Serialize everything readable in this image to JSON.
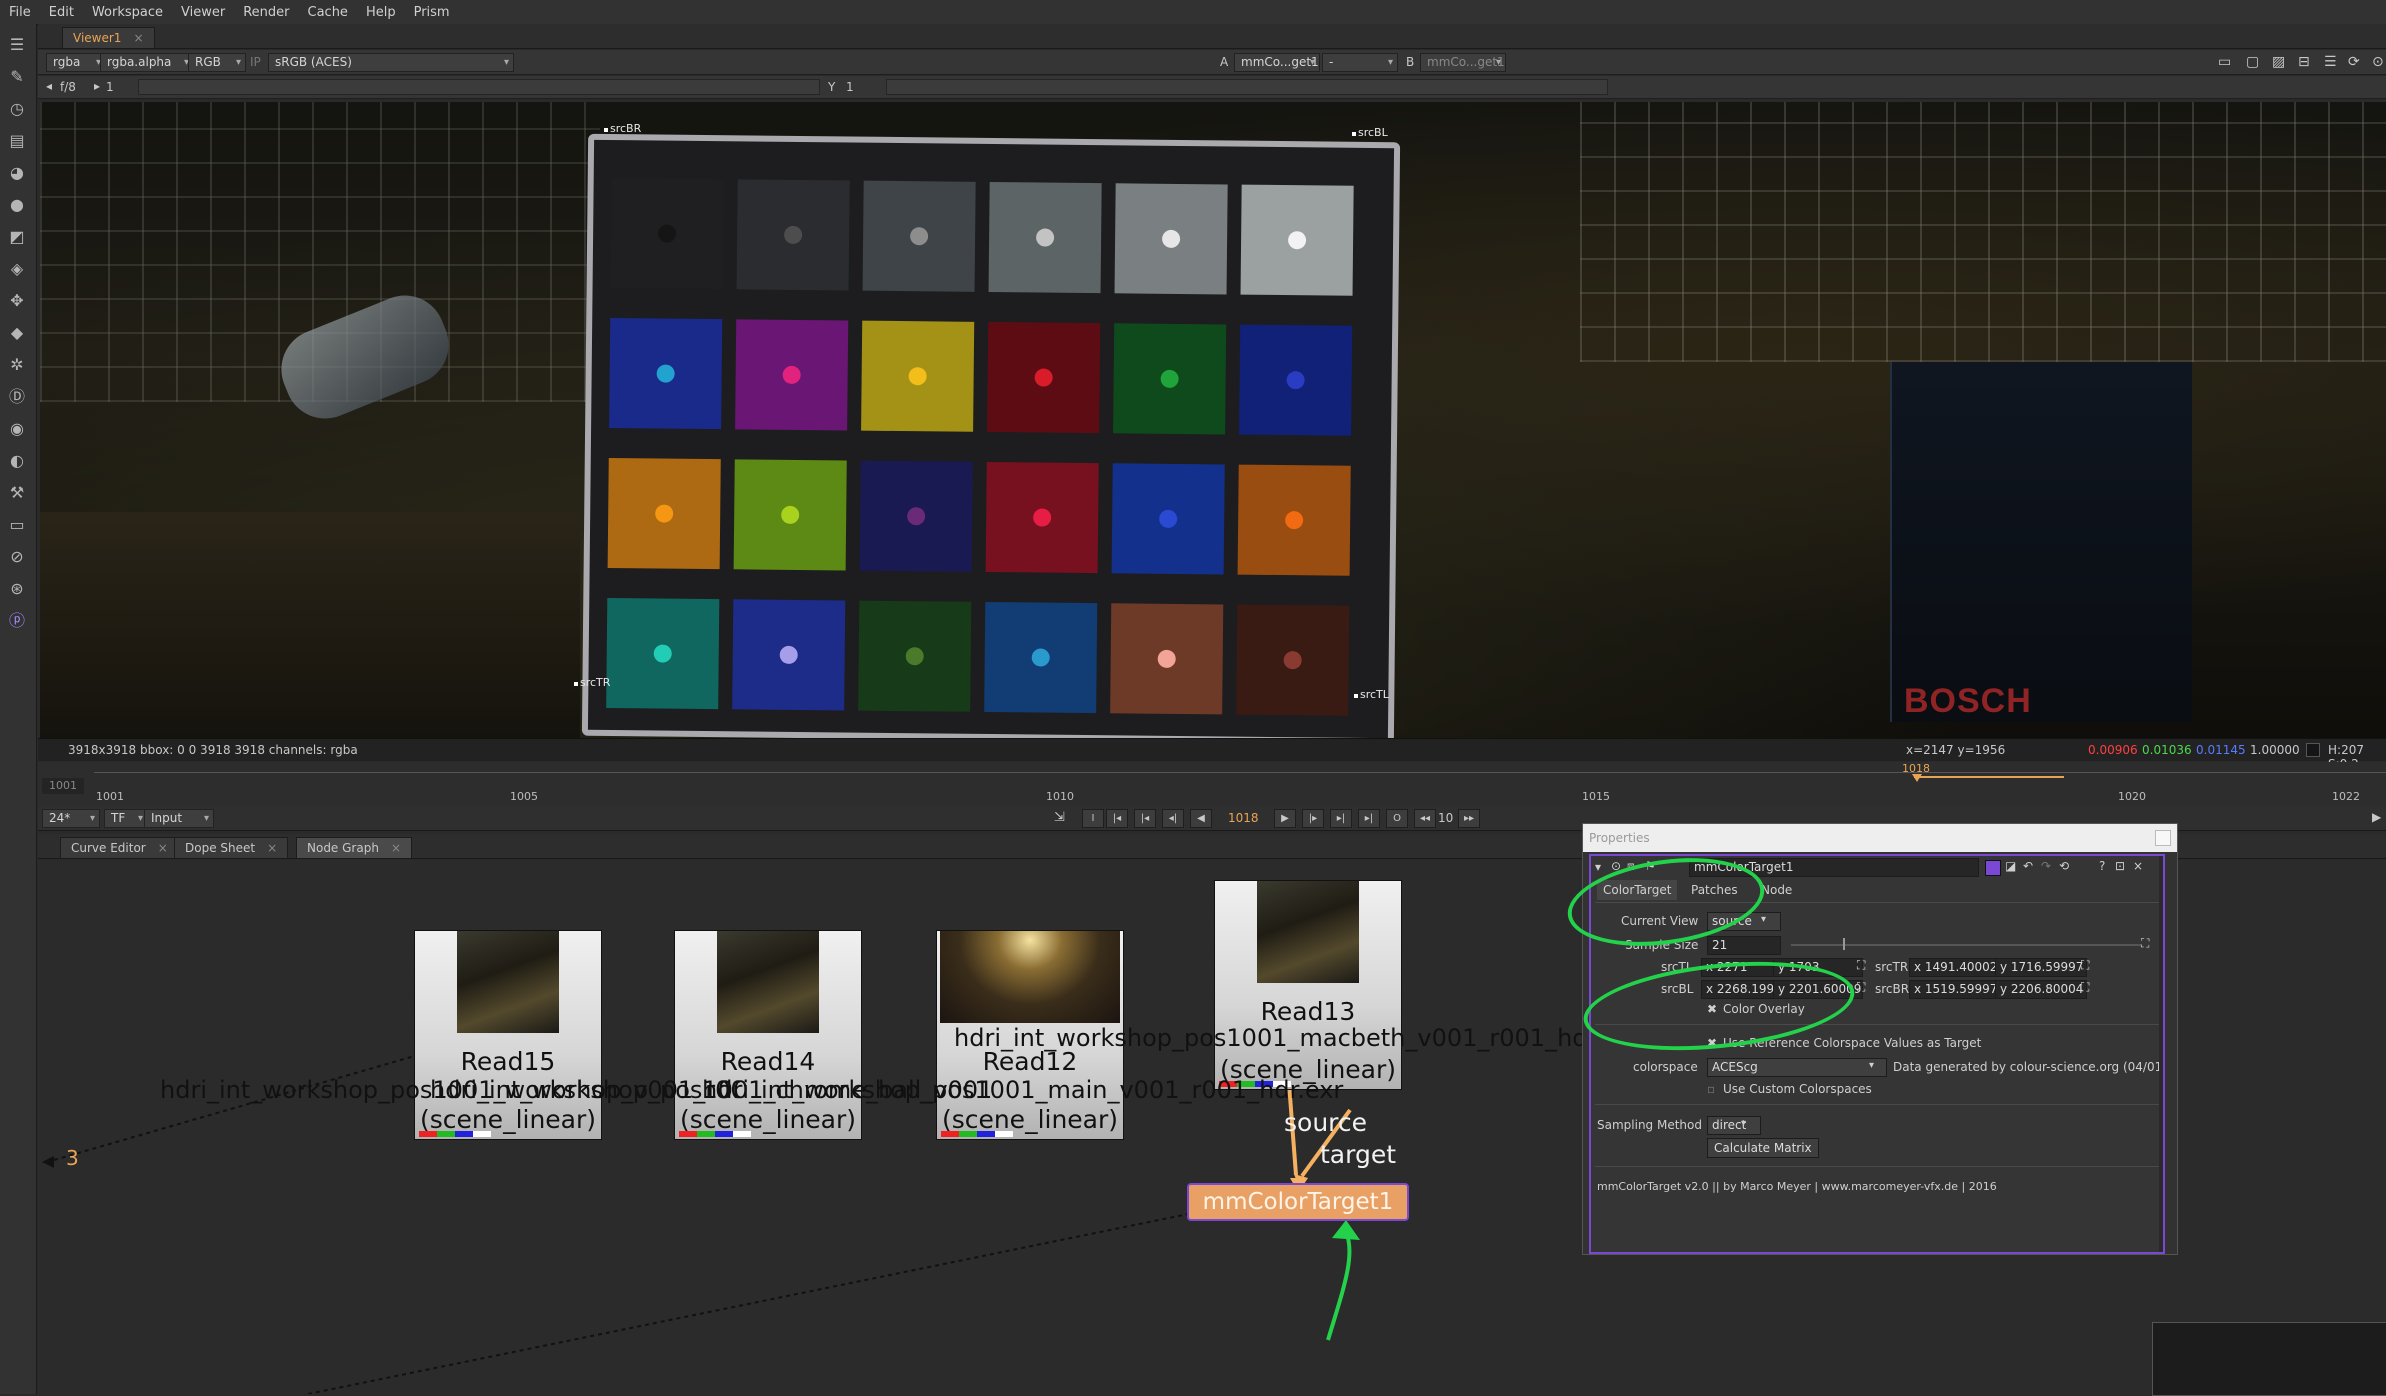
{
  "menubar": [
    "File",
    "Edit",
    "Workspace",
    "Viewer",
    "Render",
    "Cache",
    "Help",
    "Prism"
  ],
  "viewer": {
    "tab_label": "Viewer1",
    "channels": "rgba",
    "alpha": "rgba.alpha",
    "display_channels": "RGB",
    "ip_label": "IP",
    "lut": "sRGB (ACES)",
    "a_label": "A",
    "a_input": "mmCo...get1",
    "a_mode": "-",
    "b_label": "B",
    "b_input": "mmCo...get1",
    "fstop": "f/8",
    "gain_value": "1",
    "y_label": "Y",
    "gamma_value": "1",
    "info_left": "3918x3918  bbox: 0 0 3918 3918 channels: rgba",
    "coords": "x=2147 y=1956",
    "pixel_r": "0.00906",
    "pixel_g": "0.01036",
    "pixel_b": "0.01145",
    "pixel_a": "1.00000",
    "hsv": "H:207 S:0.2",
    "colors": {
      "r": "#ff4040",
      "g": "#4cd94c",
      "b": "#5a7bff"
    }
  },
  "chart_corners": {
    "tl": "srcBR",
    "tr": "srcBL",
    "bl": "srcTR",
    "br": "srcTL"
  },
  "chart_patches": [
    [
      "#1f1f22",
      "#2a2c2f",
      "#3e4448",
      "#5d6466",
      "#7a8081",
      "#9ba0a1"
    ],
    [
      "#1a2a8a",
      "#6a1675",
      "#a49217",
      "#5e0c14",
      "#0f4a1c",
      "#102177"
    ],
    [
      "#ad6a12",
      "#5c8a14",
      "#1a1a52",
      "#77101f",
      "#13318c",
      "#9a4d10"
    ],
    [
      "#10675f",
      "#1c2c88",
      "#173a19",
      "#113c74",
      "#6e3a28",
      "#3a1b14"
    ]
  ],
  "chart_dots": [
    [
      "#151515",
      "#4d4d4d",
      "#8d8d8d",
      "#c3c3c3",
      "#e6e6e6",
      "#f2f2f2"
    ],
    [
      "#22a3cf",
      "#e1237e",
      "#f3bd1a",
      "#d81c2a",
      "#21a33b",
      "#2a3cc2"
    ],
    [
      "#f59713",
      "#a9d21e",
      "#6a2a76",
      "#e81d45",
      "#2a4ad4",
      "#f26a12"
    ],
    [
      "#22cdb6",
      "#a69ee8",
      "#4a7a2a",
      "#2a9acd",
      "#f2a597",
      "#8a3b31"
    ]
  ],
  "wordmark": "BOSCH",
  "timeline": {
    "start": "1001",
    "ticks": [
      "1001",
      "1005",
      "1010",
      "1015",
      "1020",
      "1022"
    ],
    "current_marker": "1018",
    "fps": "24*",
    "tf": "TF",
    "input": "Input",
    "current_frame": "1018",
    "step": "10"
  },
  "panel_tabs": {
    "curve_editor": "Curve Editor",
    "dope_sheet": "Dope Sheet",
    "node_graph": "Node Graph"
  },
  "nodes": {
    "read15": {
      "name": "Read15",
      "cs": "(scene_linear)"
    },
    "read14": {
      "name": "Read14",
      "cs": "(scene_linear)"
    },
    "read12": {
      "name": "Read12",
      "cs": "(scene_linear)"
    },
    "read13": {
      "name": "Read13",
      "cs": "(scene_linear)"
    },
    "filename_a": "hdri_int_workshop_pos1001_workshop_v001_r001_hdr.exr",
    "filename_b": "hdri_int_workshop_pos1001_chrome_ball_v001_r001_hdr.exr",
    "filename_c": "hdri_int_workshop_pos1001_main_v001_r001_hdr.exr",
    "filename_top": "hdri_int_workshop_pos1001_macbeth_v001_r001_hdr.exr",
    "pipe_source": "source",
    "pipe_target": "target",
    "colortarget_node": "mmColorTarget1",
    "offscreen_label": "3"
  },
  "properties": {
    "title": "Properties",
    "node_name": "mmColorTarget1",
    "tabs": [
      "ColorTarget",
      "Patches",
      "Node"
    ],
    "current_view_label": "Current View",
    "current_view": "source",
    "sample_size_label": "Sample Size",
    "sample_size": "21",
    "srcTL_label": "srcTL",
    "srcTL_x": "x 2271",
    "srcTL_y": "y 1703",
    "srcTR_label": "srcTR",
    "srcTR_x": "x 1491.40002",
    "srcTR_y": "y 1716.59997",
    "srcBL_label": "srcBL",
    "srcBL_x": "x 2268.19995",
    "srcBL_y": "y 2201.60009",
    "srcBR_label": "srcBR",
    "srcBR_x": "x 1519.59997",
    "srcBR_y": "y 2206.80004",
    "color_overlay": "Color Overlay",
    "use_reference": "Use Reference Colorspace Values as Target",
    "colorspace_label": "colorspace",
    "colorspace": "ACEScg",
    "data_generated": "Data generated by colour-science.org (04/01",
    "use_custom": "Use Custom Colorspaces",
    "sampling_method_label": "Sampling Method",
    "sampling_method": "direct",
    "calculate_matrix": "Calculate Matrix",
    "credits": "mmColorTarget  v2.0  ||  by Marco Meyer  |  www.marcomeyer-vfx.de  |  2016"
  }
}
